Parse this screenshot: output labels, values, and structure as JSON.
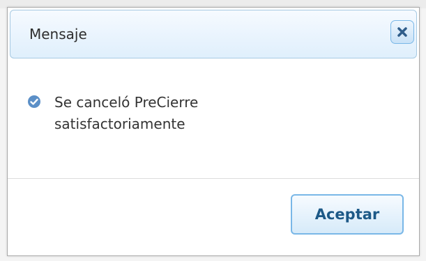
{
  "dialog": {
    "title": "Mensaje",
    "close_icon": "close-icon",
    "message_icon": "check-circle-icon",
    "message_line1": "Se canceló PreCierre",
    "message_line2": "satisfactoriamente",
    "accept_label": "Aceptar"
  },
  "colors": {
    "accent": "#79b7e7",
    "titlebar_border": "#a6c9e2",
    "button_text": "#1d5987",
    "icon_blue": "#5b8fc7"
  }
}
